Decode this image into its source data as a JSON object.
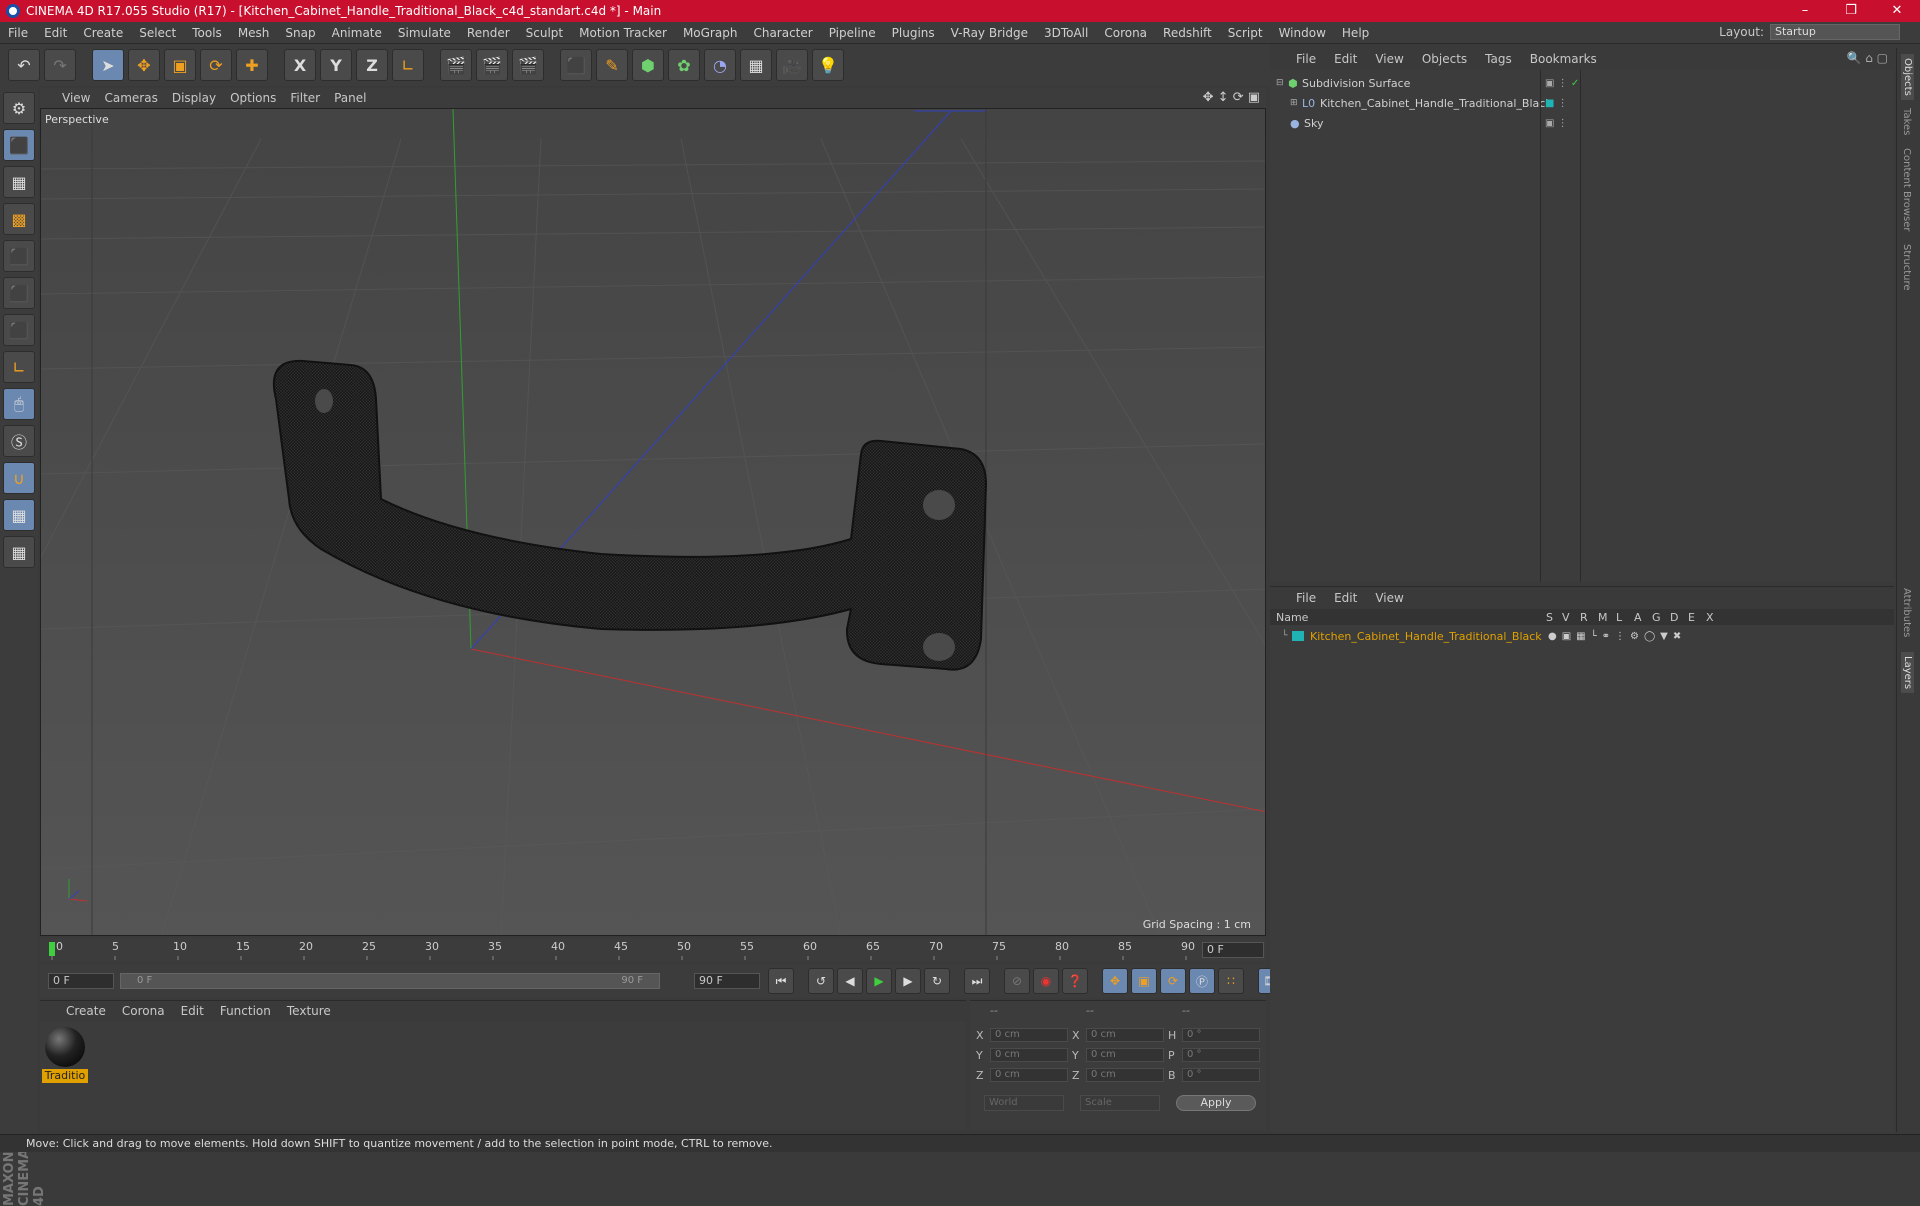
{
  "window": {
    "title": "CINEMA 4D R17.055 Studio (R17) - [Kitchen_Cabinet_Handle_Traditional_Black_c4d_standart.c4d *] - Main"
  },
  "menubar": {
    "items": [
      "File",
      "Edit",
      "Create",
      "Select",
      "Tools",
      "Mesh",
      "Snap",
      "Animate",
      "Simulate",
      "Render",
      "Sculpt",
      "Motion Tracker",
      "MoGraph",
      "Character",
      "Pipeline",
      "Plugins",
      "V-Ray Bridge",
      "3DToAll",
      "Corona",
      "Redshift",
      "Script",
      "Window",
      "Help"
    ],
    "layout_label": "Layout:",
    "layout_value": "Startup"
  },
  "toolbar": {
    "axis_x": "X",
    "axis_y": "Y",
    "axis_z": "Z"
  },
  "viewport": {
    "menu": [
      "View",
      "Cameras",
      "Display",
      "Options",
      "Filter",
      "Panel"
    ],
    "label": "Perspective",
    "grid_spacing": "Grid Spacing : 1 cm",
    "colors": {
      "x_axis": "#c03030",
      "y_axis": "#30a030",
      "z_axis": "#3040c0"
    }
  },
  "timeline": {
    "ticks": [
      "0",
      "5",
      "10",
      "15",
      "20",
      "25",
      "30",
      "35",
      "40",
      "45",
      "50",
      "55",
      "60",
      "65",
      "70",
      "75",
      "80",
      "85",
      "90"
    ],
    "current_frame": "0 F",
    "start_field": "0 F",
    "range_start": "0 F",
    "range_end": "90 F",
    "end_field": "90 F"
  },
  "materials": {
    "menu": [
      "Create",
      "Corona",
      "Edit",
      "Function",
      "Texture"
    ],
    "items": [
      {
        "label": "Traditio"
      }
    ]
  },
  "coords": {
    "headers": [
      "--",
      "--",
      "--"
    ],
    "rows": [
      {
        "l1": "X",
        "v1": "0 cm",
        "l2": "X",
        "v2": "0 cm",
        "l3": "H",
        "v3": "0 °"
      },
      {
        "l1": "Y",
        "v1": "0 cm",
        "l2": "Y",
        "v2": "0 cm",
        "l3": "P",
        "v3": "0 °"
      },
      {
        "l1": "Z",
        "v1": "0 cm",
        "l2": "Z",
        "v2": "0 cm",
        "l3": "B",
        "v3": "0 °"
      }
    ],
    "mode1": "World",
    "mode2": "Scale",
    "apply": "Apply"
  },
  "objects_panel": {
    "menu": [
      "File",
      "Edit",
      "View",
      "Objects",
      "Tags",
      "Bookmarks"
    ],
    "items": [
      {
        "name": "Subdivision Surface"
      },
      {
        "name": "Kitchen_Cabinet_Handle_Traditional_Black"
      },
      {
        "name": "Sky"
      }
    ]
  },
  "layers_panel": {
    "menu": [
      "File",
      "Edit",
      "View"
    ],
    "columns": [
      "Name",
      "S",
      "V",
      "R",
      "M",
      "L",
      "A",
      "G",
      "D",
      "E",
      "X"
    ],
    "items": [
      {
        "name": "Kitchen_Cabinet_Handle_Traditional_Black",
        "color": "#e0a000"
      }
    ]
  },
  "right_tabs": [
    "Objects",
    "Takes",
    "Content Browser",
    "Structure",
    "Attributes",
    "Layers"
  ],
  "logo": {
    "text": "MAXON CINEMA 4D"
  },
  "status": {
    "text": "Move: Click and drag to move elements. Hold down SHIFT to quantize movement / add to the selection in point mode, CTRL to remove."
  }
}
